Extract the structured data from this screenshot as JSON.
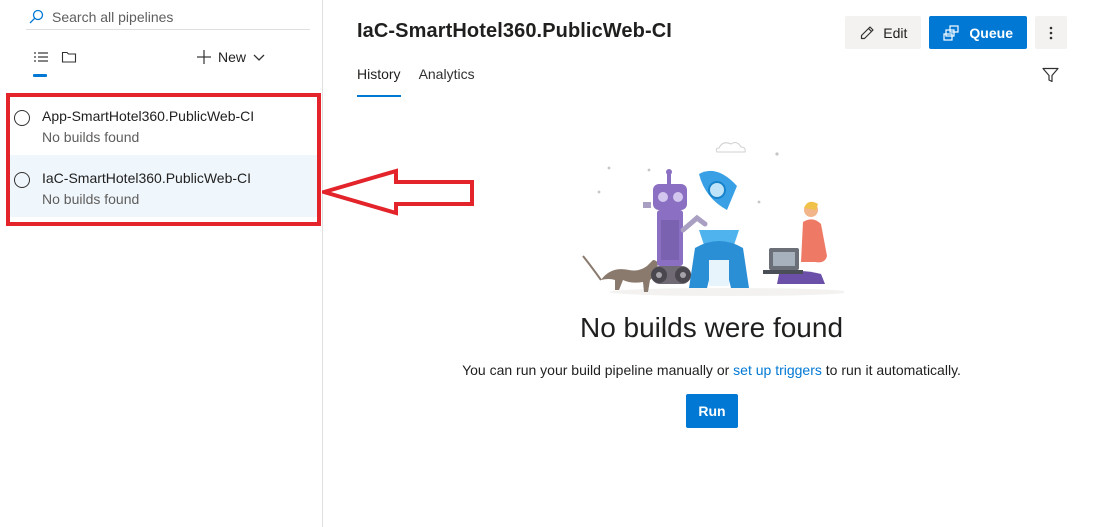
{
  "search": {
    "placeholder": "Search all pipelines"
  },
  "toolbar": {
    "new_label": "New"
  },
  "pipelines": [
    {
      "name": "App-SmartHotel360.PublicWeb-CI",
      "status": "No builds found",
      "selected": false
    },
    {
      "name": "IaC-SmartHotel360.PublicWeb-CI",
      "status": "No builds found",
      "selected": true
    }
  ],
  "header": {
    "title": "IaC-SmartHotel360.PublicWeb-CI",
    "edit_label": "Edit",
    "queue_label": "Queue"
  },
  "tabs": [
    {
      "label": "History",
      "active": true
    },
    {
      "label": "Analytics",
      "active": false
    }
  ],
  "empty_state": {
    "title": "No builds were found",
    "text_before": "You can run your build pipeline manually or ",
    "link_text": "set up triggers",
    "text_after": " to run it automatically.",
    "run_label": "Run"
  },
  "colors": {
    "accent": "#0078d4",
    "highlight": "#e3242b",
    "selected_row": "#eff6fc"
  }
}
